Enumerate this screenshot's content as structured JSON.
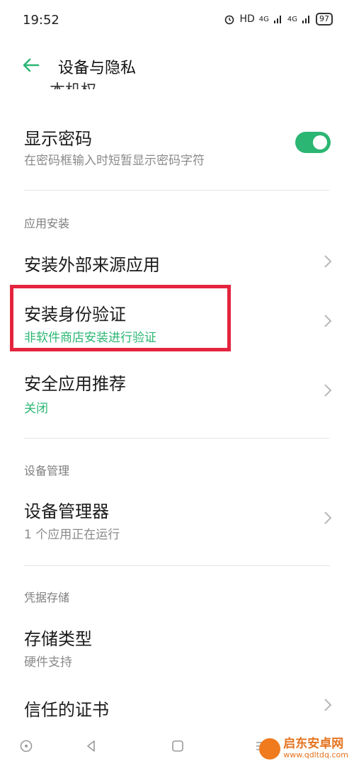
{
  "status_bar": {
    "time": "19:52",
    "network": "HD",
    "signal1": "4G",
    "signal2": "4G",
    "battery": "97"
  },
  "header": {
    "title": "设备与隐私"
  },
  "partial_item": "本机权",
  "show_password": {
    "title": "显示密码",
    "subtitle": "在密码框输入时短暂显示密码字符",
    "enabled": true
  },
  "sections": {
    "app_install": "应用安装",
    "device_manage": "设备管理",
    "credential_storage": "凭据存储"
  },
  "items": {
    "install_external": {
      "title": "安装外部来源应用"
    },
    "install_verify": {
      "title": "安装身份验证",
      "subtitle": "非软件商店安装进行验证"
    },
    "security_recommend": {
      "title": "安全应用推荐",
      "subtitle": "关闭"
    },
    "device_admin": {
      "title": "设备管理器",
      "subtitle": "1 个应用正在运行"
    },
    "storage_type": {
      "title": "存储类型",
      "subtitle": "硬件支持"
    },
    "trusted_certs": {
      "title": "信任的证书"
    }
  },
  "watermark": {
    "name": "启东安卓网",
    "url": "www.qdltdq.com"
  },
  "colors": {
    "accent": "#2bb673",
    "highlight": "#e4243e"
  }
}
